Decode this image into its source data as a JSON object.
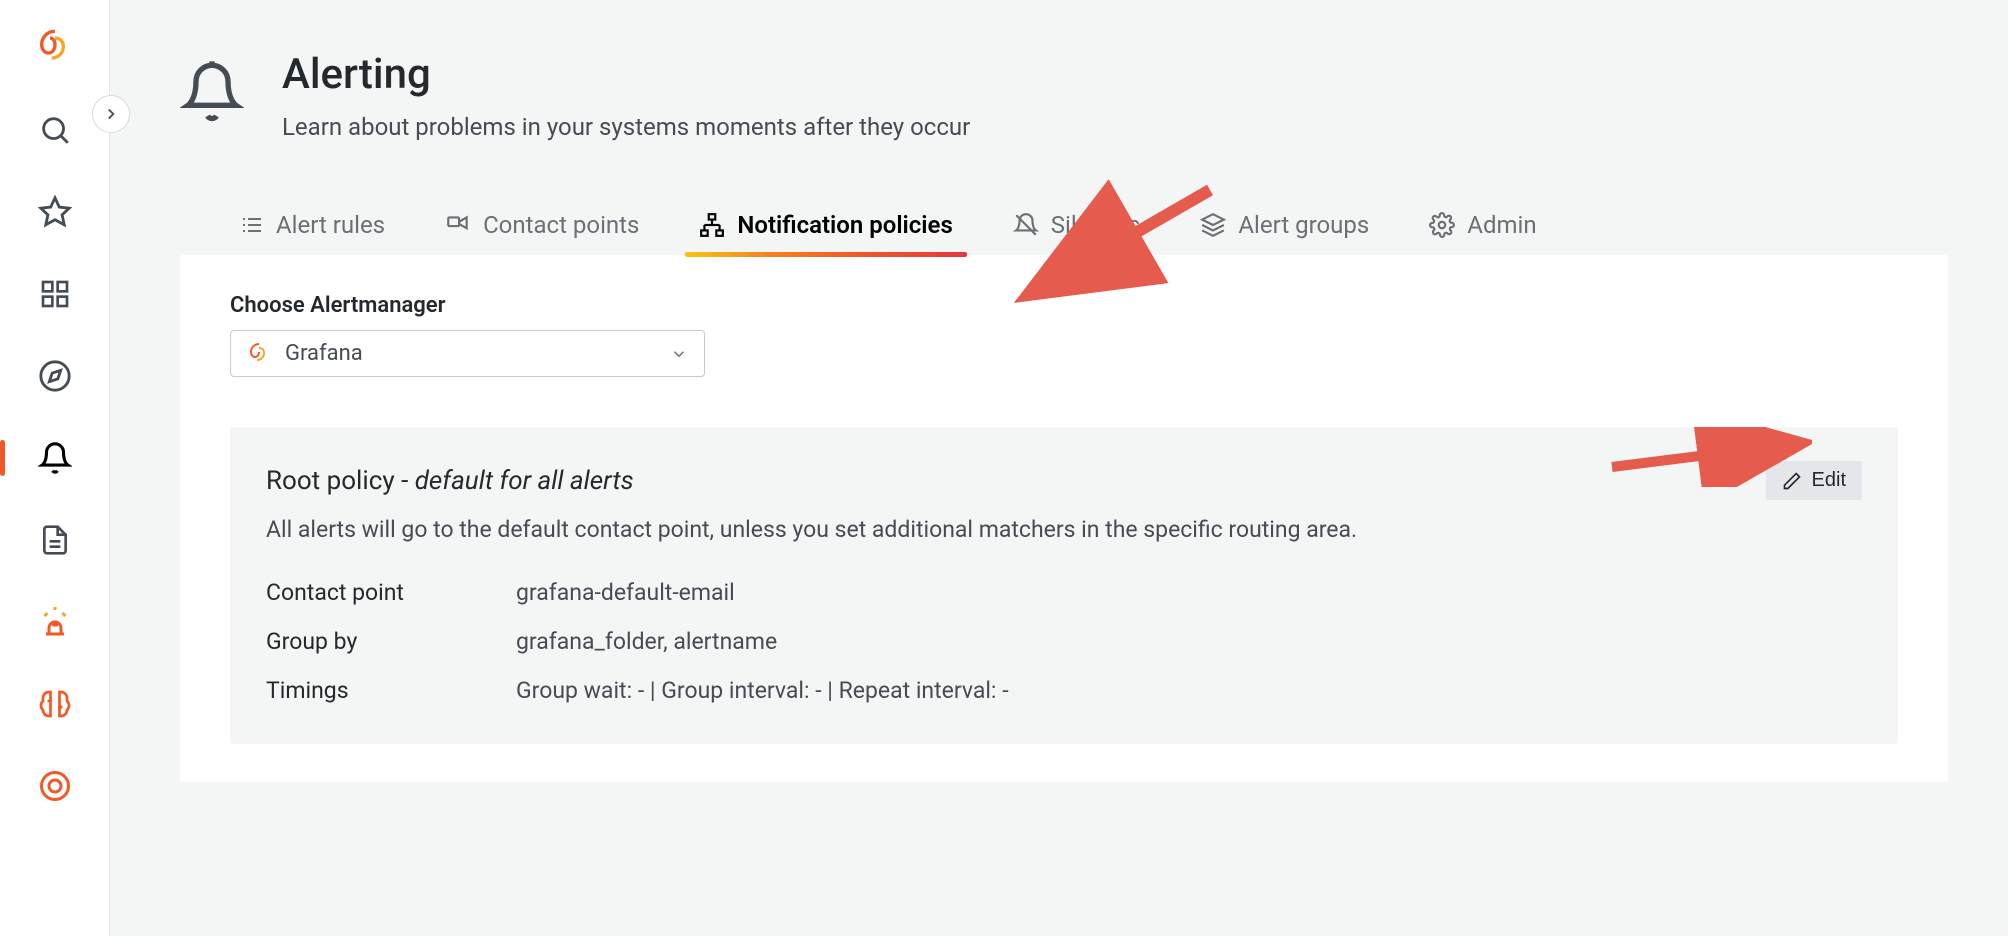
{
  "page": {
    "title": "Alerting",
    "subtitle": "Learn about problems in your systems moments after they occur"
  },
  "tabs": {
    "alert_rules": "Alert rules",
    "contact_points": "Contact points",
    "notification_policies": "Notification policies",
    "silences": "Silences",
    "alert_groups": "Alert groups",
    "admin": "Admin"
  },
  "alertmanager": {
    "choose_label": "Choose Alertmanager",
    "selected": "Grafana"
  },
  "root_policy": {
    "title_prefix": "Root policy - ",
    "title_italic": "default for all alerts",
    "description": "All alerts will go to the default contact point, unless you set additional matchers in the specific routing area.",
    "contact_point_label": "Contact point",
    "contact_point_value": "grafana-default-email",
    "group_by_label": "Group by",
    "group_by_value": "grafana_folder, alertname",
    "timings_label": "Timings",
    "timings_value": "Group wait: - | Group interval: - | Repeat interval: -",
    "edit_label": "Edit"
  }
}
